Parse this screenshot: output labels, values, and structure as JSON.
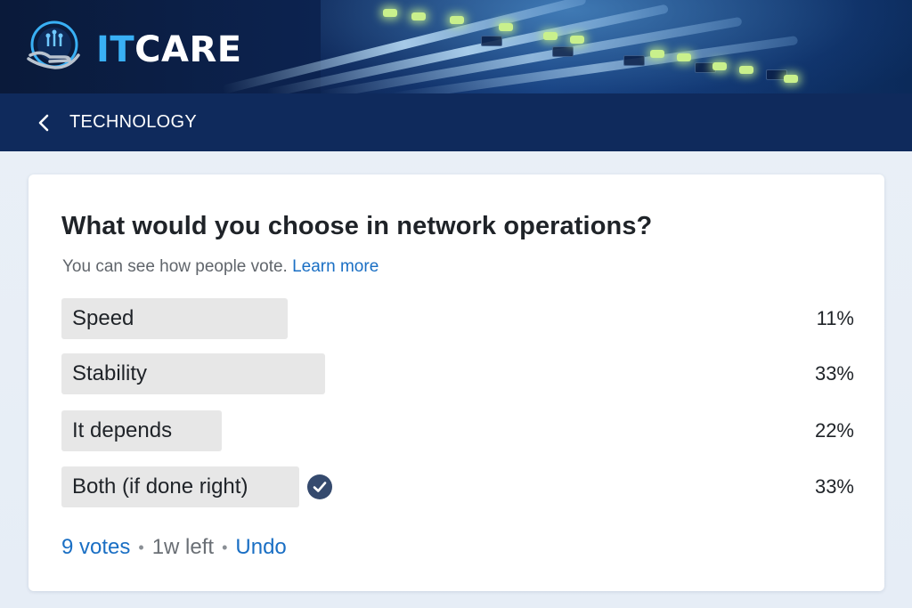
{
  "brand": {
    "name_part1": "IT",
    "name_part2": "CARE",
    "accent": "#39b0f5"
  },
  "nav": {
    "back_icon": "chevron-left-icon",
    "title": "TECHNOLOGY"
  },
  "poll": {
    "question": "What would you choose in network operations?",
    "subtitle": "You can see how people vote.",
    "learn_more": "Learn more",
    "options": [
      {
        "label": "Speed",
        "percent_text": "11%",
        "bar_fraction": 0.285,
        "selected": false
      },
      {
        "label": "Stability",
        "percent_text": "33%",
        "bar_fraction": 0.333,
        "selected": false
      },
      {
        "label": "It depends",
        "percent_text": "22%",
        "bar_fraction": 0.202,
        "selected": false
      },
      {
        "label": "Both (if done right)",
        "percent_text": "33%",
        "bar_fraction": 0.3,
        "selected": true
      }
    ],
    "votes": "9 votes",
    "time_left": "1w left",
    "undo": "Undo",
    "separator": "•"
  },
  "colors": {
    "navbar": "#0f2a5c",
    "link": "#1a6fc4",
    "bar": "#e7e7e7",
    "check": "#354a6e"
  }
}
